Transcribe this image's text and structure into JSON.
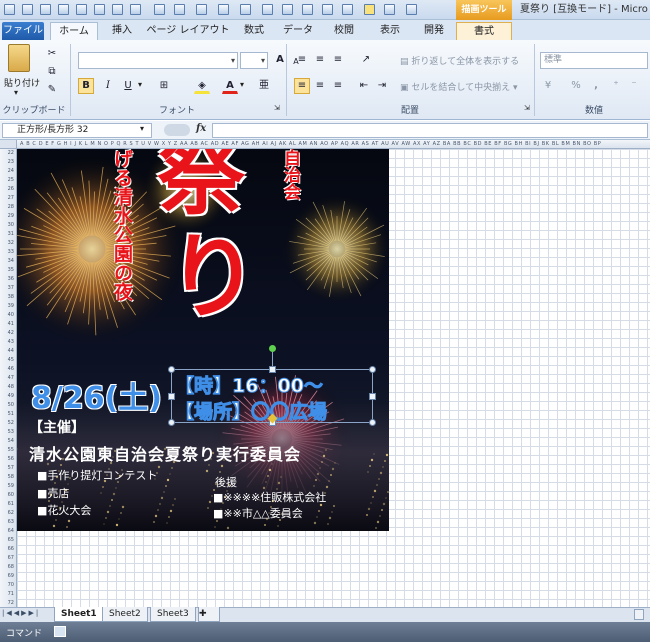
{
  "title": {
    "drawing_tools": "描画ツール",
    "window_title": "夏祭り [互換モード] - Micro"
  },
  "tabs": {
    "file": "ファイル",
    "home": "ホーム",
    "insert": "挿入",
    "page_layout": "ページ レイアウト",
    "formulas": "数式",
    "data": "データ",
    "review": "校閲",
    "view": "表示",
    "developer": "開発",
    "format": "書式"
  },
  "ribbon": {
    "paste_label": "貼り付け",
    "clipboard_label": "クリップボード",
    "font_label": "フォント",
    "alignment_label": "配置",
    "number_label": "数値",
    "wrap_text": "折り返して全体を表示する",
    "merge_center": "セルを結合して中央揃え",
    "number_format": "標準",
    "bold": "B",
    "italic": "I",
    "underline": "U",
    "grow_font": "A",
    "shrink_font": "A",
    "font_color_glyph": "A",
    "percent": "%",
    "comma": ","
  },
  "formula_bar": {
    "name_box": "正方形/長方形 32",
    "fx": "fx"
  },
  "grid": {
    "column_header_text": "A B C D E F G H I J K L M N O P Q R S T U V W X Y Z AA AB AC AD AE AF AG AH AI AJ AK AL AM AN AO AP AQ AR AS AT AU AV AW AX AY AZ BA BB BC BD BE BF BG BH BI BJ BK BL BM BN BO BP",
    "first_row": 22
  },
  "poster": {
    "title_big_1": "祭",
    "title_big_2": "り",
    "vertical_left": "げる清水公園の夜",
    "vertical_right": "自治会",
    "date": "8/26(土)",
    "time_line": "【時】16：00〜",
    "place_line": "【場所】〇〇広場",
    "organizer_label": "【主催】",
    "organizer": "清水公園東自治会夏祭り実行委員会",
    "events": [
      "■手作り提灯コンテスト",
      "■売店",
      "■花火大会"
    ],
    "sponsor_label": "後援",
    "sponsors": [
      "■※※※※住販株式会社",
      "■※※市△△委員会"
    ]
  },
  "sheets": {
    "tabs": [
      "Sheet1",
      "Sheet2",
      "Sheet3"
    ],
    "active": "Sheet1"
  },
  "status": {
    "mode": "コマンド"
  },
  "colors": {
    "title_red": "#e8141a",
    "date_blue": "#3f8fe8",
    "file_tab": "#2a6bbf",
    "drawing_tools": "#f0ac30"
  }
}
